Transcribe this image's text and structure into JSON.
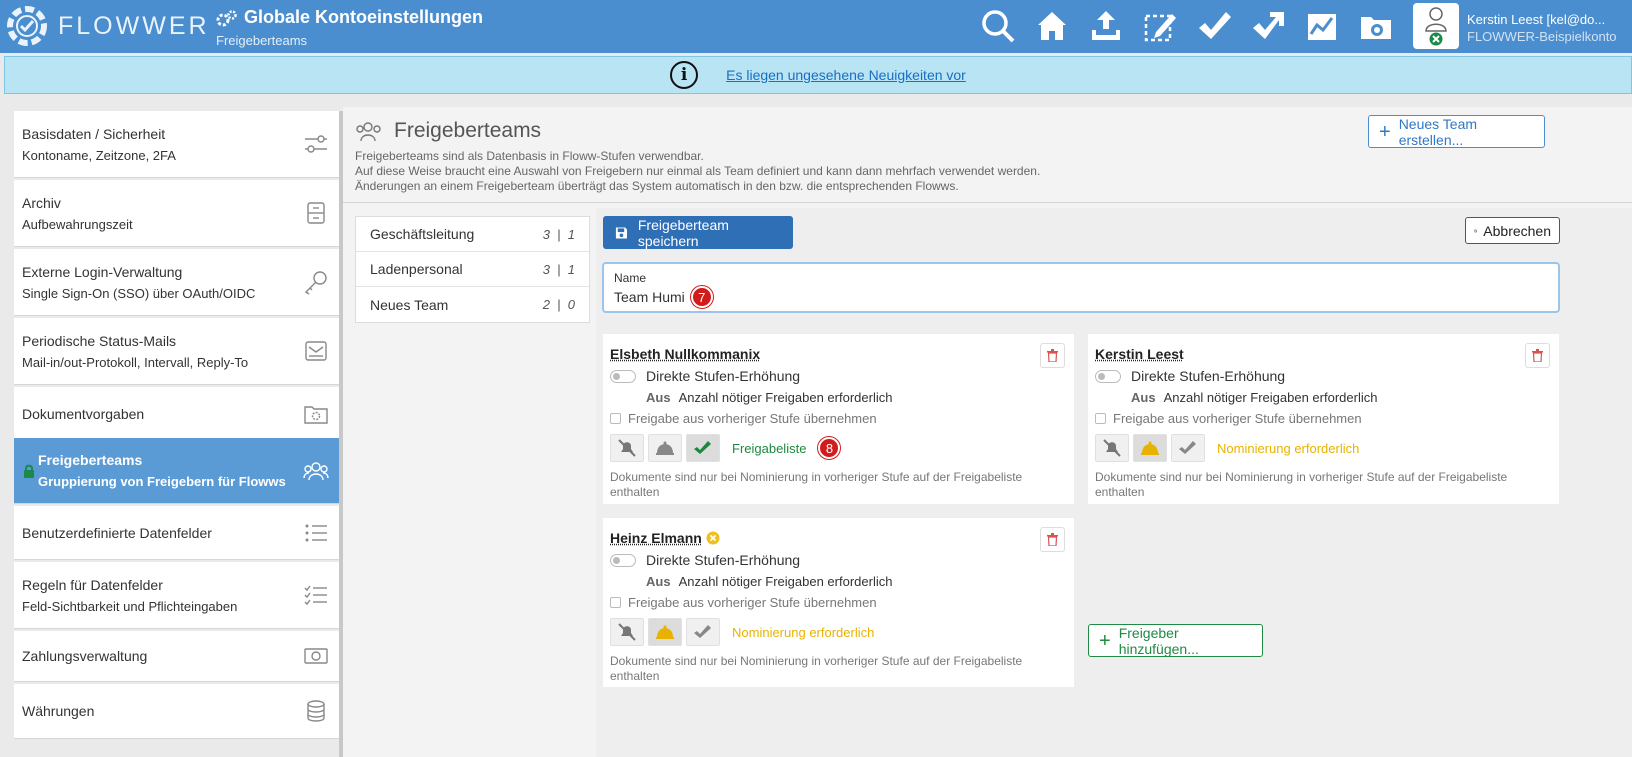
{
  "app": {
    "brand": "FLOWWER"
  },
  "header": {
    "title": "Globale Kontoeinstellungen",
    "subtitle": "Freigeberteams",
    "tools": [
      "search-icon",
      "home-icon",
      "upload-icon",
      "selection-edit-icon",
      "approve-pen-icon",
      "forward-arrow-icon",
      "chart-icon",
      "camera-folder-icon"
    ],
    "user": {
      "name": "Kerstin Leest [kel@do...",
      "account": "FLOWWER-Beispielkonto"
    }
  },
  "banner": {
    "link": "Es liegen ungesehene Neuigkeiten vor"
  },
  "sidebar": {
    "items": [
      {
        "title": "Basisdaten / Sicherheit",
        "subtitle": "Kontoname, Zeitzone, 2FA",
        "icon": "sliders-icon"
      },
      {
        "title": "Archiv",
        "subtitle": "Aufbewahrungszeit",
        "icon": "archive-icon"
      },
      {
        "title": "Externe Login-Verwaltung",
        "subtitle": "Single Sign-On (SSO) über OAuth/OIDC",
        "icon": "key-icon"
      },
      {
        "title": "Periodische Status-Mails",
        "subtitle": "Mail-in/out-Protokoll, Intervall, Reply-To",
        "icon": "mail-icon"
      },
      {
        "title": "Dokumentvorgaben",
        "subtitle": "",
        "icon": "folder-gear-icon"
      },
      {
        "title": "Freigeberteams",
        "subtitle": "Gruppierung von Freigebern für Flowws",
        "icon": "team-icon",
        "active": true
      },
      {
        "title": "Benutzerdefinierte Datenfelder",
        "subtitle": "",
        "icon": "list-icon"
      },
      {
        "title": "Regeln für Datenfelder",
        "subtitle": "Feld-Sichtbarkeit und Pflichteingaben",
        "icon": "checklist-icon"
      },
      {
        "title": "Zahlungsverwaltung",
        "subtitle": "",
        "icon": "money-icon"
      },
      {
        "title": "Währungen",
        "subtitle": "",
        "icon": "coins-icon"
      }
    ]
  },
  "main": {
    "title": "Freigeberteams",
    "desc": [
      "Freigeberteams sind als Datenbasis in Floww-Stufen verwendbar.",
      "Auf diese Weise braucht eine Auswahl von Freigebern nur einmal als Team definiert und kann dann mehrfach verwendet werden.",
      "Änderungen an einem Freigeberteam überträgt das System automatisch in den bzw. die entsprechenden Flowws."
    ],
    "new_team_button": "Neues Team erstellen...",
    "teams": [
      {
        "name": "Geschäftsleitung",
        "a": "3",
        "b": "1"
      },
      {
        "name": "Ladenpersonal",
        "a": "3",
        "b": "1"
      },
      {
        "name": "Neues Team",
        "a": "2",
        "b": "0"
      }
    ],
    "save_button": "Freigeberteam speichern",
    "cancel_button": "Abbrechen",
    "name_label": "Name",
    "name_value": "Team Humi",
    "marker_name": "7",
    "marker_mode": "8",
    "add_button": "Freigeber hinzufügen...",
    "approvers": [
      {
        "name": "Elsbeth Nullkommanix",
        "toggle_label": "Direkte Stufen-Erhöhung",
        "aus": "Aus",
        "aus_text": "Anzahl nötiger Freigaben erforderlich",
        "checkbox": "Freigabe aus vorheriger Stufe übernehmen",
        "mode": "Freigabeliste",
        "note": "Dokumente sind nur bei Nominierung in vorheriger Stufe auf der Freigabeliste enthalten"
      },
      {
        "name": "Kerstin Leest",
        "toggle_label": "Direkte Stufen-Erhöhung",
        "aus": "Aus",
        "aus_text": "Anzahl nötiger Freigaben erforderlich",
        "checkbox": "Freigabe aus vorheriger Stufe übernehmen",
        "mode": "Nominierung erforderlich",
        "note": "Dokumente sind nur bei Nominierung in vorheriger Stufe auf der Freigabeliste enthalten"
      },
      {
        "name": "Heinz Elmann",
        "toggle_label": "Direkte Stufen-Erhöhung",
        "aus": "Aus",
        "aus_text": "Anzahl nötiger Freigaben erforderlich",
        "checkbox": "Freigabe aus vorheriger Stufe übernehmen",
        "mode": "Nominierung erforderlich",
        "note": "Dokumente sind nur bei Nominierung in vorheriger Stufe auf der Freigabeliste enthalten"
      }
    ]
  },
  "colors": {
    "header": "#4a8ed0",
    "active": "#5b9bd5",
    "save": "#2e6fb5",
    "green": "#1b8a3e",
    "yellow": "#e8b300",
    "danger": "#d21c1c"
  }
}
